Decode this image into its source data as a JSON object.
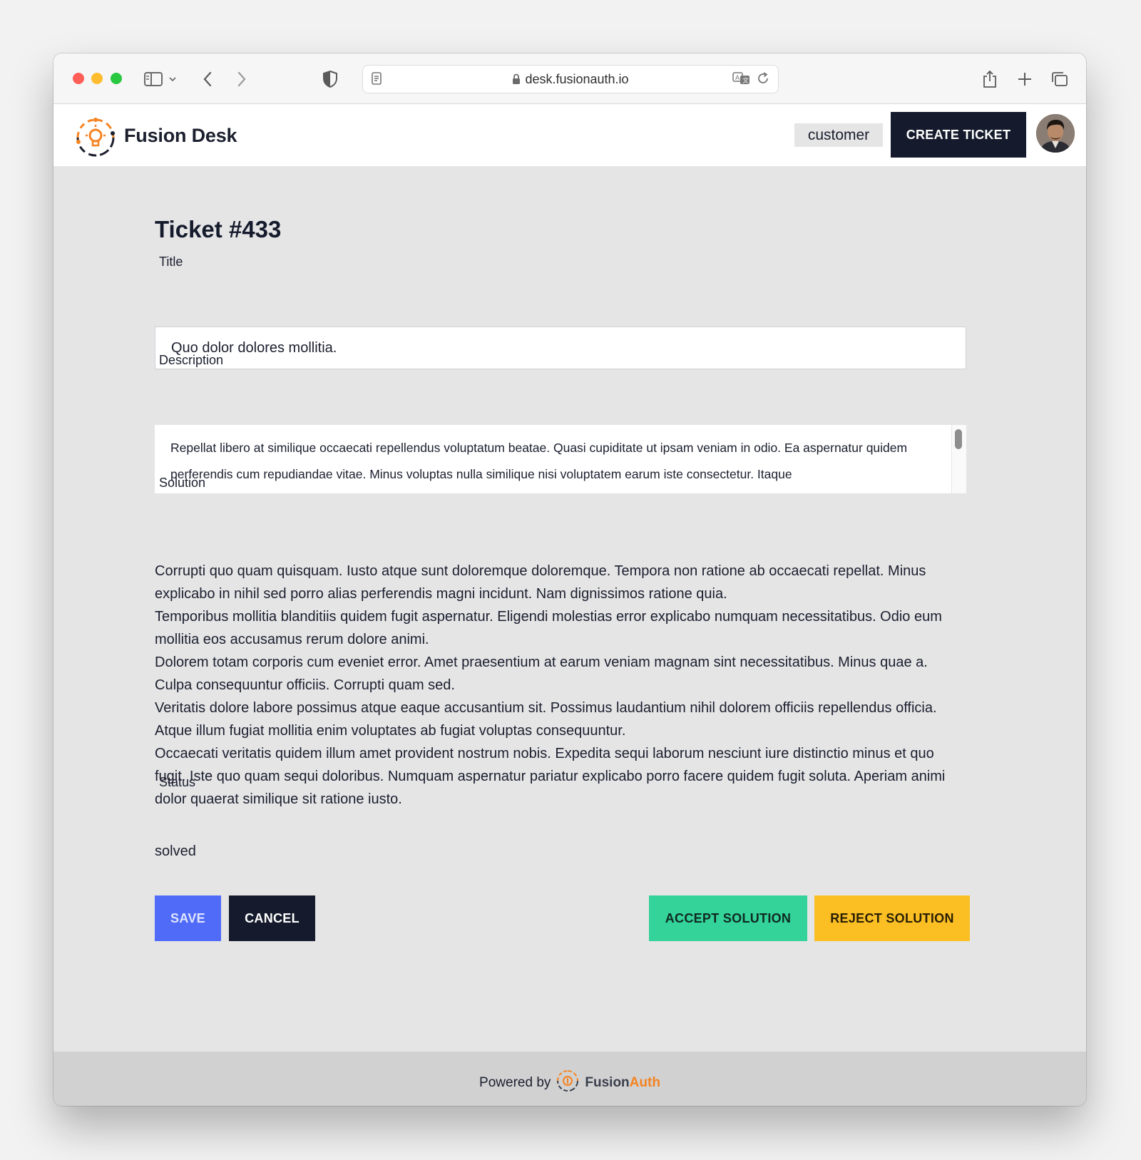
{
  "browser": {
    "url": "desk.fusionauth.io"
  },
  "header": {
    "brand": "Fusion Desk",
    "role": "customer",
    "create_ticket_label": "CREATE TICKET"
  },
  "ticket": {
    "heading": "Ticket #433",
    "title_label": "Title",
    "title_value": "Quo dolor dolores mollitia.",
    "description_label": "Description",
    "description_value": "Repellat libero at similique occaecati repellendus voluptatum beatae. Quasi cupiditate ut ipsam veniam in odio. Ea aspernatur quidem perferendis cum repudiandae vitae. Minus voluptas nulla similique nisi voluptatem earum iste consectetur. Itaque",
    "solution_label": "Solution",
    "solution_paragraphs": [
      "Corrupti quo quam quisquam. Iusto atque sunt doloremque doloremque. Tempora non ratione ab occaecati repellat. Minus explicabo in nihil sed porro alias perferendis magni incidunt. Nam dignissimos ratione quia.",
      "Temporibus mollitia blanditiis quidem fugit aspernatur. Eligendi molestias error explicabo numquam necessitatibus. Odio eum mollitia eos accusamus rerum dolore animi.",
      "Dolorem totam corporis cum eveniet error. Amet praesentium at earum veniam magnam sint necessitatibus. Minus quae a. Culpa consequuntur officiis. Corrupti quam sed.",
      "Veritatis dolore labore possimus atque eaque accusantium sit. Possimus laudantium nihil dolorem officiis repellendus officia. Atque illum fugiat mollitia enim voluptates ab fugiat voluptas consequuntur.",
      "Occaecati veritatis quidem illum amet provident nostrum nobis. Expedita sequi laborum nesciunt iure distinctio minus et quo fugit. Iste quo quam sequi doloribus. Numquam aspernatur pariatur explicabo porro facere quidem fugit soluta. Aperiam animi dolor quaerat similique sit ratione iusto."
    ],
    "status_label": "Status",
    "status_value": "solved"
  },
  "actions": {
    "save": "SAVE",
    "cancel": "CANCEL",
    "accept": "ACCEPT SOLUTION",
    "reject": "REJECT SOLUTION"
  },
  "footer": {
    "powered_by": "Powered by",
    "brand_fusion": "Fusion",
    "brand_auth": "Auth"
  },
  "colors": {
    "primary_dark": "#151b2c",
    "save_blue": "#4f6bf7",
    "accept_green": "#34d399",
    "reject_yellow": "#fbbf24",
    "brand_orange": "#f58320",
    "page_background": "#e5e5e6"
  },
  "icons": {
    "traffic_lights": [
      "close-dot",
      "minimize-dot",
      "zoom-dot"
    ],
    "toolbar": [
      "sidebar-icon",
      "chevron-down-icon",
      "back-icon",
      "forward-icon",
      "shield-icon",
      "page-icon",
      "lock-icon",
      "translate-icon",
      "reload-icon",
      "share-icon",
      "new-tab-icon",
      "tabs-overview-icon"
    ]
  }
}
